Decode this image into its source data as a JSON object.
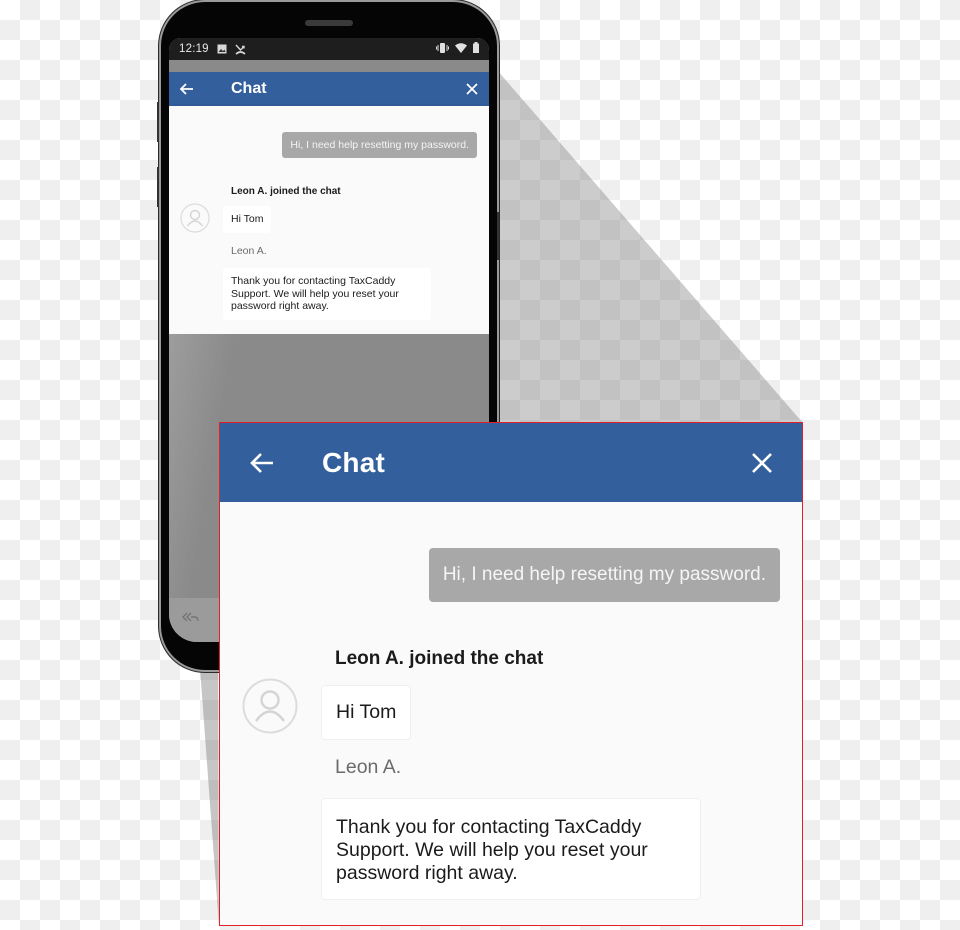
{
  "status_bar": {
    "time": "12:19",
    "left_icons": [
      "image-icon",
      "missed-call-icon"
    ],
    "right_icons": [
      "vibrate-icon",
      "wifi-icon",
      "battery-icon"
    ]
  },
  "chat": {
    "title": "Chat",
    "back_icon": "arrow-left-icon",
    "close_icon": "close-icon",
    "messages": {
      "outgoing": "Hi, I need help resetting my password.",
      "joined_notice": "Leon A.  joined the chat",
      "agent_greeting": "Hi Tom",
      "agent_name": "Leon A.",
      "agent_reply": "Thank you for contacting TaxCaddy Support. We will help you reset your password right away."
    },
    "avatar_icon": "user-avatar-icon"
  },
  "lower_bar": {
    "reply_icon": "reply-all-icon"
  },
  "colors": {
    "header_blue": "#335f9c",
    "outgoing_bubble": "#a8a8a8",
    "highlight_border": "#e0202a",
    "chat_background": "#fafafa"
  }
}
